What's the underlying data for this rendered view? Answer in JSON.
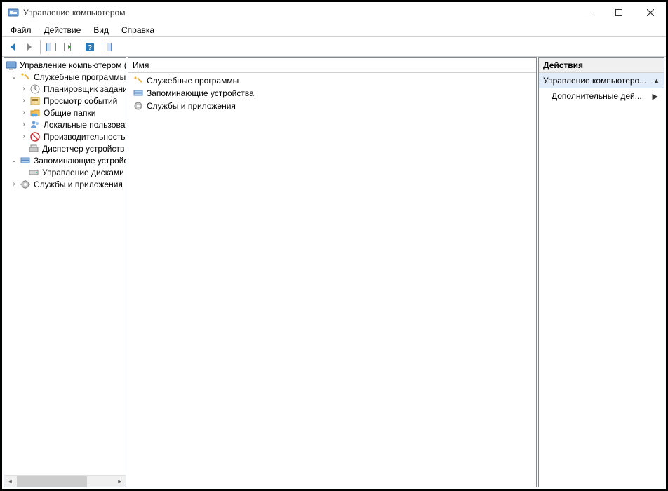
{
  "window": {
    "title": "Управление компьютером"
  },
  "menu": {
    "file": "Файл",
    "action": "Действие",
    "view": "Вид",
    "help": "Справка"
  },
  "tree": {
    "root": "Управление компьютером (л",
    "system_tools": "Служебные программы",
    "task_scheduler": "Планировщик заданий",
    "event_viewer": "Просмотр событий",
    "shared_folders": "Общие папки",
    "local_users": "Локальные пользовате",
    "performance": "Производительность",
    "device_manager": "Диспетчер устройств",
    "storage": "Запоминающие устройст",
    "disk_mgmt": "Управление дисками",
    "services_apps": "Службы и приложения"
  },
  "list": {
    "header_name": "Имя",
    "items": [
      "Служебные программы",
      "Запоминающие устройства",
      "Службы и приложения"
    ]
  },
  "actions": {
    "title": "Действия",
    "selected": "Управление компьютеро...",
    "more": "Дополнительные дей..."
  }
}
